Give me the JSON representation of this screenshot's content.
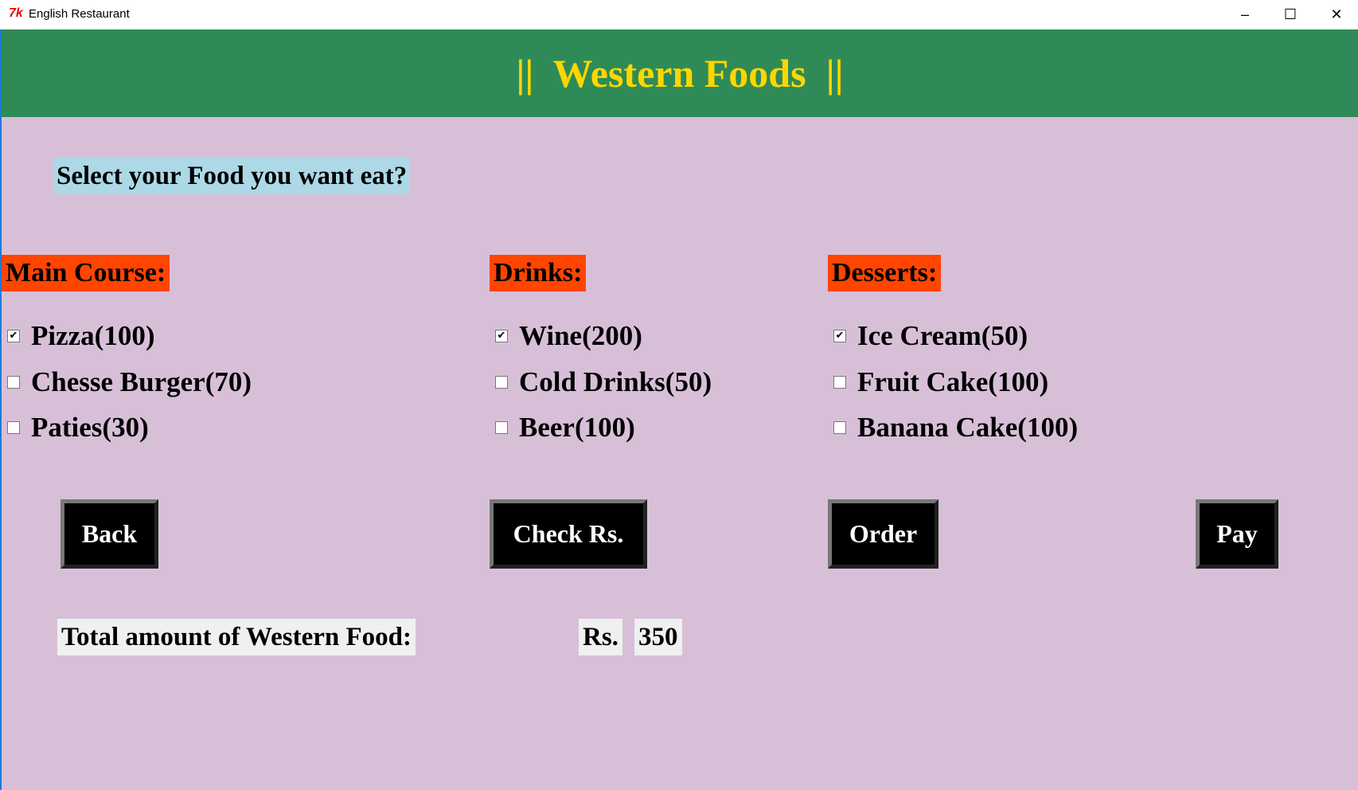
{
  "window": {
    "title": "English Restaurant",
    "icon": "tk-feather-icon",
    "controls": [
      "minimize",
      "maximize",
      "close"
    ]
  },
  "header": {
    "title": "||  Western Foods  ||"
  },
  "prompt": "Select your Food you want eat?",
  "sections": [
    {
      "label": "Main Course:",
      "items": [
        {
          "label": "Pizza(100)",
          "checked": true
        },
        {
          "label": "Chesse Burger(70)",
          "checked": false
        },
        {
          "label": "Paties(30)",
          "checked": false
        }
      ]
    },
    {
      "label": "Drinks:",
      "items": [
        {
          "label": "Wine(200)",
          "checked": true
        },
        {
          "label": "Cold Drinks(50)",
          "checked": false
        },
        {
          "label": "Beer(100)",
          "checked": false
        }
      ]
    },
    {
      "label": "Desserts:",
      "items": [
        {
          "label": "Ice Cream(50)",
          "checked": true
        },
        {
          "label": "Fruit Cake(100)",
          "checked": false
        },
        {
          "label": "Banana Cake(100)",
          "checked": false
        }
      ]
    }
  ],
  "buttons": {
    "back": "Back",
    "check": "Check Rs.",
    "order": "Order",
    "pay": "Pay"
  },
  "total": {
    "label": "Total amount of Western Food:",
    "currency": "Rs.",
    "value": "350"
  },
  "colors": {
    "header_bg": "#2e8b57",
    "header_text": "#ffd700",
    "bg": "#d8bfd8",
    "section_bg": "#ff4500",
    "prompt_bg": "#add8e6"
  }
}
